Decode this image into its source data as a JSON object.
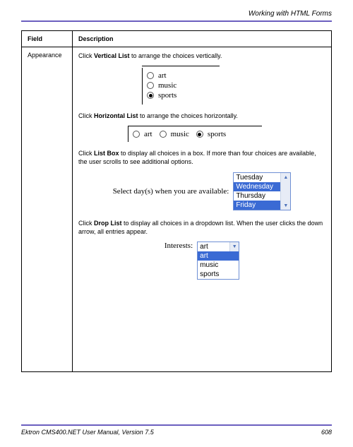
{
  "header": {
    "section_title": "Working with HTML Forms"
  },
  "table": {
    "headers": {
      "field": "Field",
      "desc": "Description"
    },
    "row": {
      "field_name": "Appearance",
      "p1_pre": "Click ",
      "p1_bold": "Vertical List",
      "p1_post": " to arrange the choices vertically.",
      "vlist": {
        "items": [
          "art",
          "music",
          "sports"
        ],
        "selected_index": 2
      },
      "p2_pre": "Click ",
      "p2_bold": "Horizontal List",
      "p2_post": " to arrange the choices horizontally.",
      "hlist": {
        "items": [
          "art",
          "music",
          "sports"
        ],
        "selected_index": 2
      },
      "p3_pre": "Click ",
      "p3_bold": "List Box",
      "p3_post": " to display all choices in a box. If more than four choices are available, the user scrolls to see additional options.",
      "listbox": {
        "prompt": "Select day(s) when you are available:",
        "items": [
          "Tuesday",
          "Wednesday",
          "Thursday",
          "Friday"
        ],
        "selected_indices": [
          1,
          3
        ]
      },
      "p4_pre": "Click ",
      "p4_bold": "Drop List",
      "p4_post": " to display all choices in a dropdown list. When the user clicks the down arrow, all entries appear.",
      "droplist": {
        "label": "Interests:",
        "selected": "art",
        "items": [
          "art",
          "music",
          "sports"
        ],
        "highlighted_index": 0
      }
    }
  },
  "footer": {
    "manual": "Ektron CMS400.NET User Manual, Version 7.5",
    "page": "608"
  }
}
